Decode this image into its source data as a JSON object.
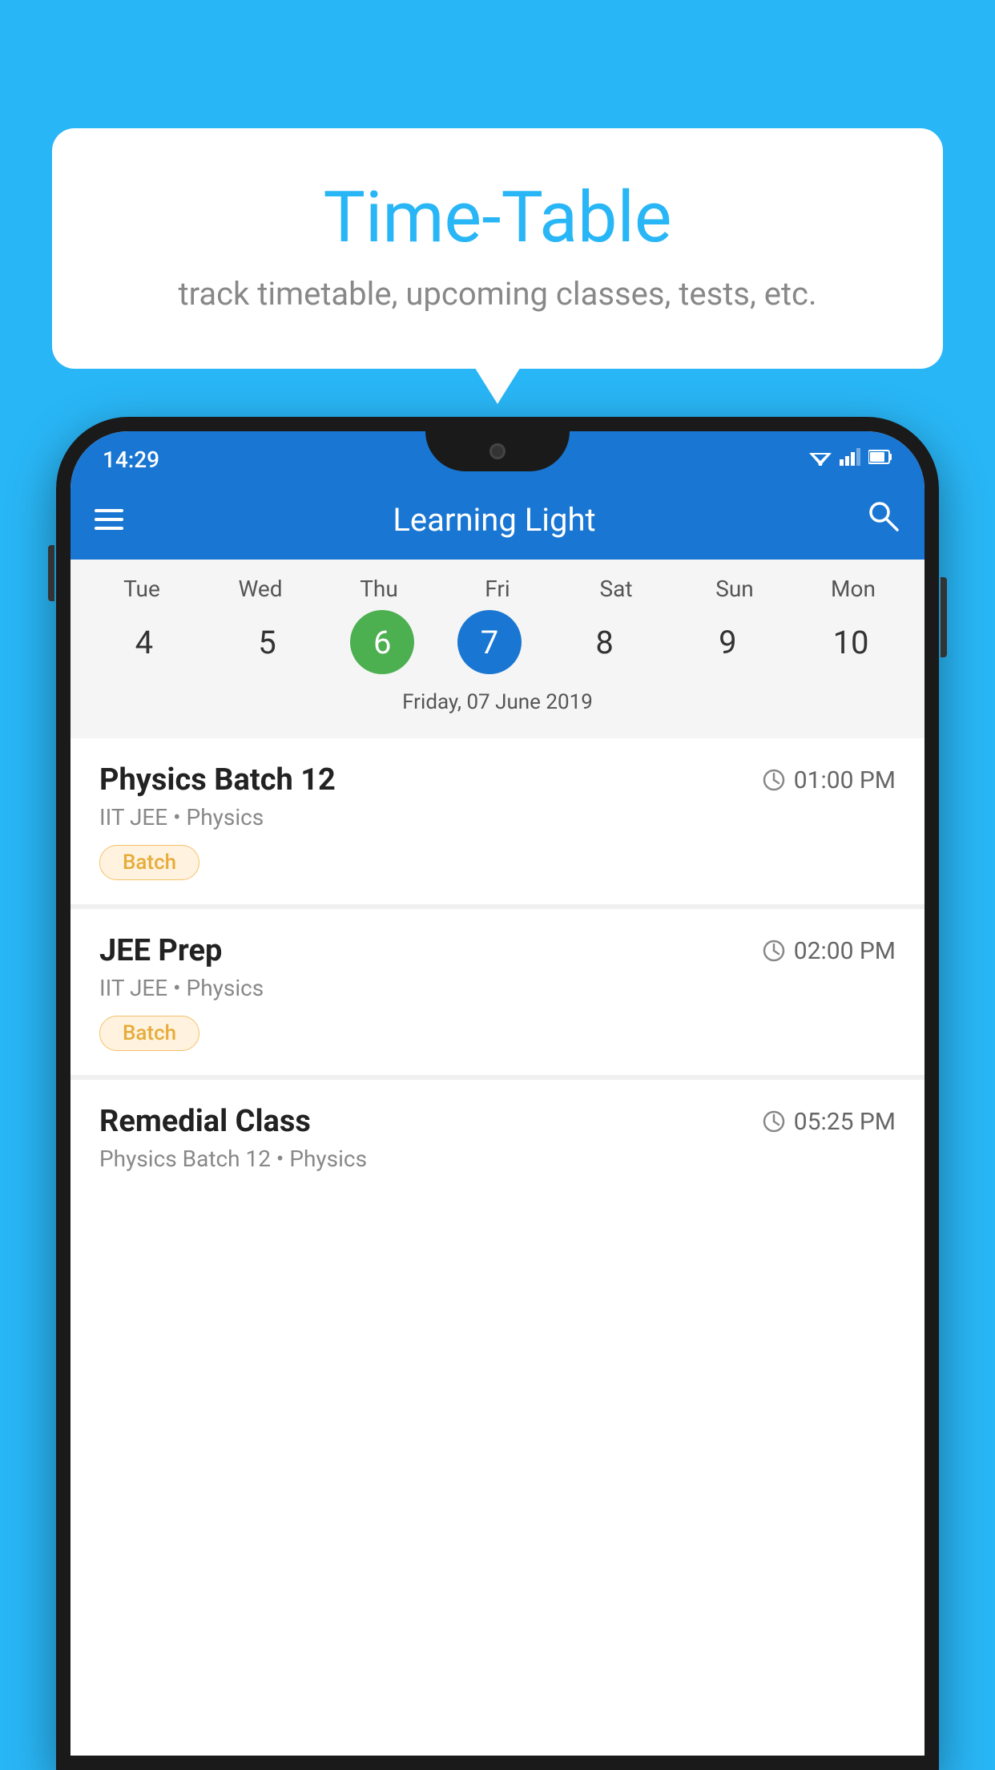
{
  "page": {
    "background_color": "#29B6F6"
  },
  "tooltip": {
    "title": "Time-Table",
    "subtitle": "track timetable, upcoming classes, tests, etc."
  },
  "phone": {
    "status_bar": {
      "time": "14:29"
    },
    "app_bar": {
      "title": "Learning Light"
    },
    "calendar": {
      "day_names": [
        "Tue",
        "Wed",
        "Thu",
        "Fri",
        "Sat",
        "Sun",
        "Mon"
      ],
      "day_numbers": [
        "4",
        "5",
        "6",
        "7",
        "8",
        "9",
        "10"
      ],
      "today_index": 2,
      "selected_index": 3,
      "selected_date_label": "Friday, 07 June 2019"
    },
    "schedule": [
      {
        "title": "Physics Batch 12",
        "time": "01:00 PM",
        "subtitle": "IIT JEE • Physics",
        "badge": "Batch"
      },
      {
        "title": "JEE Prep",
        "time": "02:00 PM",
        "subtitle": "IIT JEE • Physics",
        "badge": "Batch"
      },
      {
        "title": "Remedial Class",
        "time": "05:25 PM",
        "subtitle": "Physics Batch 12 • Physics",
        "badge": null
      }
    ]
  },
  "icons": {
    "hamburger": "☰",
    "search": "🔍",
    "clock": "⏱"
  }
}
